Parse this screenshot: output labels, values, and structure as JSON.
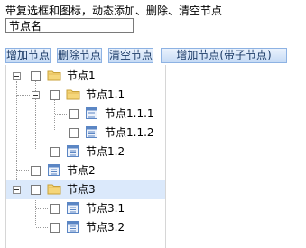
{
  "heading": "带复选框和图标，动态添加、删除、清空节点",
  "input": {
    "value": "节点名"
  },
  "toolbar": {
    "add_label": "增加节点",
    "delete_label": "删除节点",
    "clear_label": "清空节点",
    "add_child_label": "增加节点(带子节点)"
  },
  "tree": {
    "nodes": [
      {
        "label": "节点1",
        "icon": "folder-icon",
        "expanded": true,
        "checked": false,
        "selected": false
      },
      {
        "label": "节点1.1",
        "icon": "folder-icon",
        "expanded": true,
        "checked": false,
        "selected": false
      },
      {
        "label": "节点1.1.1",
        "icon": "document-icon",
        "checked": false,
        "selected": false
      },
      {
        "label": "节点1.1.2",
        "icon": "document-icon",
        "checked": false,
        "selected": false
      },
      {
        "label": "节点1.2",
        "icon": "document-icon",
        "checked": false,
        "selected": false
      },
      {
        "label": "节点2",
        "icon": "document-icon",
        "checked": false,
        "selected": false
      },
      {
        "label": "节点3",
        "icon": "folder-icon",
        "expanded": true,
        "checked": false,
        "selected": true
      },
      {
        "label": "节点3.1",
        "icon": "document-icon",
        "checked": false,
        "selected": false
      },
      {
        "label": "节点3.2",
        "icon": "document-icon",
        "checked": false,
        "selected": false
      }
    ]
  },
  "colors": {
    "button_border": "#8db2e3",
    "button_gradient_top": "#eaf2fd",
    "button_gradient_bottom": "#c6dbf5",
    "selected_row": "#dbe9fb",
    "folder": "#f5d67a",
    "document": "#5b86c4"
  }
}
